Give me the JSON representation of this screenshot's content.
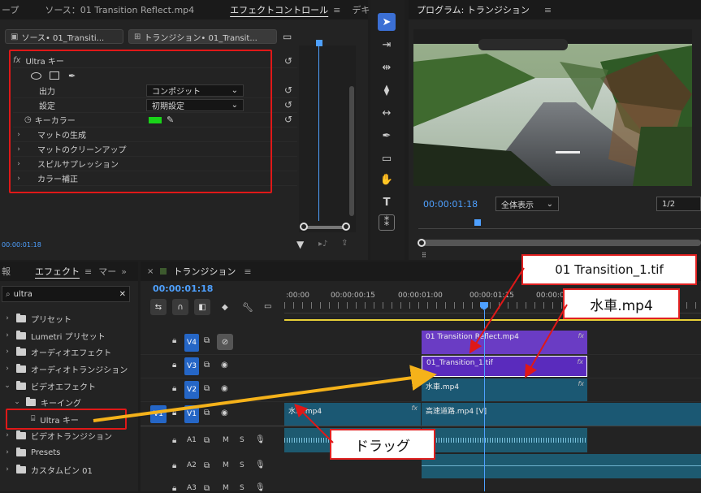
{
  "effect_controls": {
    "tab_left": "ープ",
    "tab_source": "ソース：01 Transition Reflect.mp4",
    "tab_active": "エフェクトコントロール",
    "tab_right": "デキ",
    "chip_source": "ソース• 01_Transiti...",
    "chip_sequence": "トランジション• 01_Transit...",
    "effect_name": "Ultra キー",
    "output_label": "出力",
    "output_value": "コンポジット",
    "setting_label": "設定",
    "setting_value": "初期設定",
    "keycolor_label": "キーカラー",
    "keycolor_hex": "#19d419",
    "groups": [
      "マットの生成",
      "マットのクリーンアップ",
      "スピルサプレッション",
      "カラー補正"
    ],
    "timecode": "00:00:01:18"
  },
  "program": {
    "title": "プログラム: トランジション",
    "timecode": "00:00:01:18",
    "fit": "全体表示",
    "resolution": "1/2"
  },
  "effects_panel": {
    "tab_left": "報",
    "tab_active": "エフェクト",
    "tab_right": "マー",
    "search_value": "ultra",
    "items": [
      "プリセット",
      "Lumetri プリセット",
      "オーディオエフェクト",
      "オーディオトランジション",
      "ビデオエフェクト",
      "キーイング",
      "Ultra キー",
      "ビデオトランジション",
      "Presets",
      "カスタムビン 01"
    ]
  },
  "timeline": {
    "title": "トランジション",
    "timecode": "00:00:01:18",
    "ruler": [
      ":00:00",
      "00:00:00:15",
      "00:00:01:00",
      "00:00:01:15",
      "00:00:02:00"
    ],
    "tracks": [
      "V4",
      "V3",
      "V2",
      "V1",
      "A1",
      "A2",
      "A3"
    ],
    "clip_v4": "01 Transition Reflect.mp4",
    "clip_v3": "01_Transition_1.tif",
    "clip_v2": "水車.mp4",
    "clip_v1_left": "水車.mp4",
    "clip_v1_right": "高速道路.mp4 [V]",
    "track_m": "M",
    "track_s": "S",
    "v1_src": "V1"
  },
  "annotations": {
    "callout1": "01 Transition_1.tif",
    "callout2": "水車.mp4",
    "callout3": "ドラッグ"
  }
}
